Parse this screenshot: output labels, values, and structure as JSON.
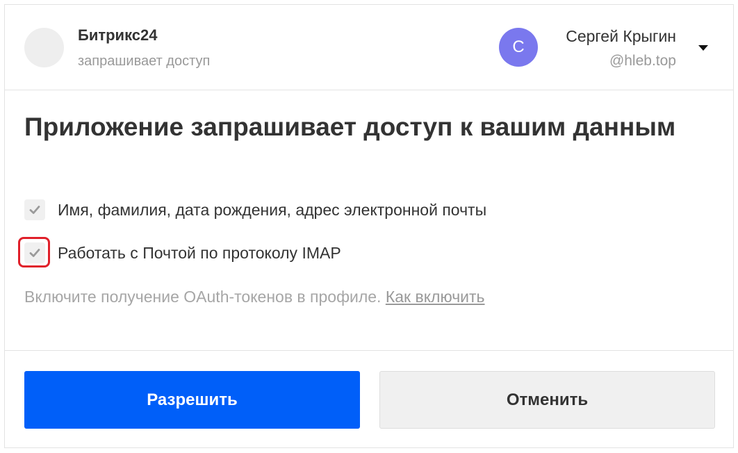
{
  "app": {
    "name": "Битрикс24",
    "subtitle": "запрашивает доступ",
    "logo_icon": "app-logo-placeholder"
  },
  "user": {
    "avatar_letter": "С",
    "avatar_color": "#7a78ee",
    "name": "Сергей Крыгин",
    "login": "@hleb.top"
  },
  "title": "Приложение запрашивает доступ к вашим данным",
  "permissions": [
    {
      "label": "Имя, фамилия, дата рождения, адрес электронной почты",
      "checked": true
    },
    {
      "label": "Работать с Почтой по протоколу IMAP",
      "checked": true
    }
  ],
  "note": {
    "text": "Включите получение OAuth-токенов в профиле.",
    "link": "Как включить"
  },
  "buttons": {
    "allow": "Разрешить",
    "cancel": "Отменить"
  },
  "colors": {
    "primary": "#005ff9",
    "highlight": "#e0202a"
  }
}
